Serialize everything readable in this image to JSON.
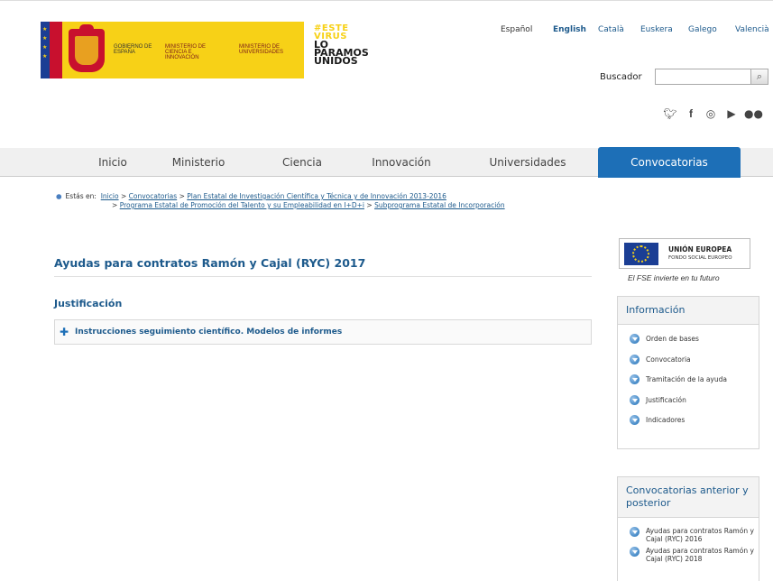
{
  "header": {
    "logo": {
      "gobierno": "GOBIERNO DE ESPAÑA",
      "ministerio_ciencia": "MINISTERIO DE CIENCIA E INNOVACIÓN",
      "ministerio_universidades": "MINISTERIO DE UNIVERSIDADES"
    },
    "campaign": {
      "line1": "#ESTE",
      "line2": "VIRUS",
      "line3": "LO",
      "line4": "PARAMOS",
      "line5": "UNIDOS"
    },
    "languages": [
      "Español",
      "English",
      "Català",
      "Euskera",
      "Galego",
      "Valencià"
    ],
    "search": {
      "label": "Buscador",
      "value": "",
      "button_icon": "magnifier-icon"
    },
    "social_icons": [
      "twitter-icon",
      "facebook-icon",
      "instagram-icon",
      "youtube-icon",
      "flickr-icon"
    ]
  },
  "nav": {
    "items": [
      {
        "label": "Inicio",
        "active": false
      },
      {
        "label": "Ministerio",
        "active": false
      },
      {
        "label": "Ciencia",
        "active": false
      },
      {
        "label": "Innovación",
        "active": false
      },
      {
        "label": "Universidades",
        "active": false
      },
      {
        "label": "Convocatorias",
        "active": true
      }
    ]
  },
  "breadcrumb": {
    "prefix": "Estás en:",
    "items": [
      "Inicio",
      "Convocatorias",
      "Plan Estatal de Investigación Científica y Técnica y de Innovación 2013-2016",
      "Programa Estatal de Promoción del Talento y su Empleabilidad en I+D+i",
      "Subprograma Estatal de Incorporación"
    ],
    "separator": ">"
  },
  "main": {
    "title": "Ayudas para contratos Ramón y Cajal (RYC) 2017",
    "section_heading": "Justificación",
    "accordion": {
      "label": "Instrucciones seguimiento científico. Modelos de informes",
      "icon": "plus-icon"
    }
  },
  "sidebar": {
    "eu": {
      "title": "UNIÓN EUROPEA",
      "subtitle": "FONDO SOCIAL EUROPEO",
      "tagline": "El FSE invierte en tu futuro"
    },
    "info_panel": {
      "title": "Información",
      "links": [
        "Orden de bases",
        "Convocatoria",
        "Tramitación de la ayuda",
        "Justificación",
        "Indicadores"
      ]
    },
    "prev_panel": {
      "title": "Convocatorias anterior y posterior",
      "links": [
        "Ayudas para contratos Ramón y Cajal (RYC) 2016",
        "Ayudas para contratos Ramón y Cajal (RYC) 2018"
      ]
    }
  },
  "colors": {
    "brand_yellow": "#f7d117",
    "link_blue": "#1d5a8c",
    "active_tab": "#1d6fb7"
  }
}
